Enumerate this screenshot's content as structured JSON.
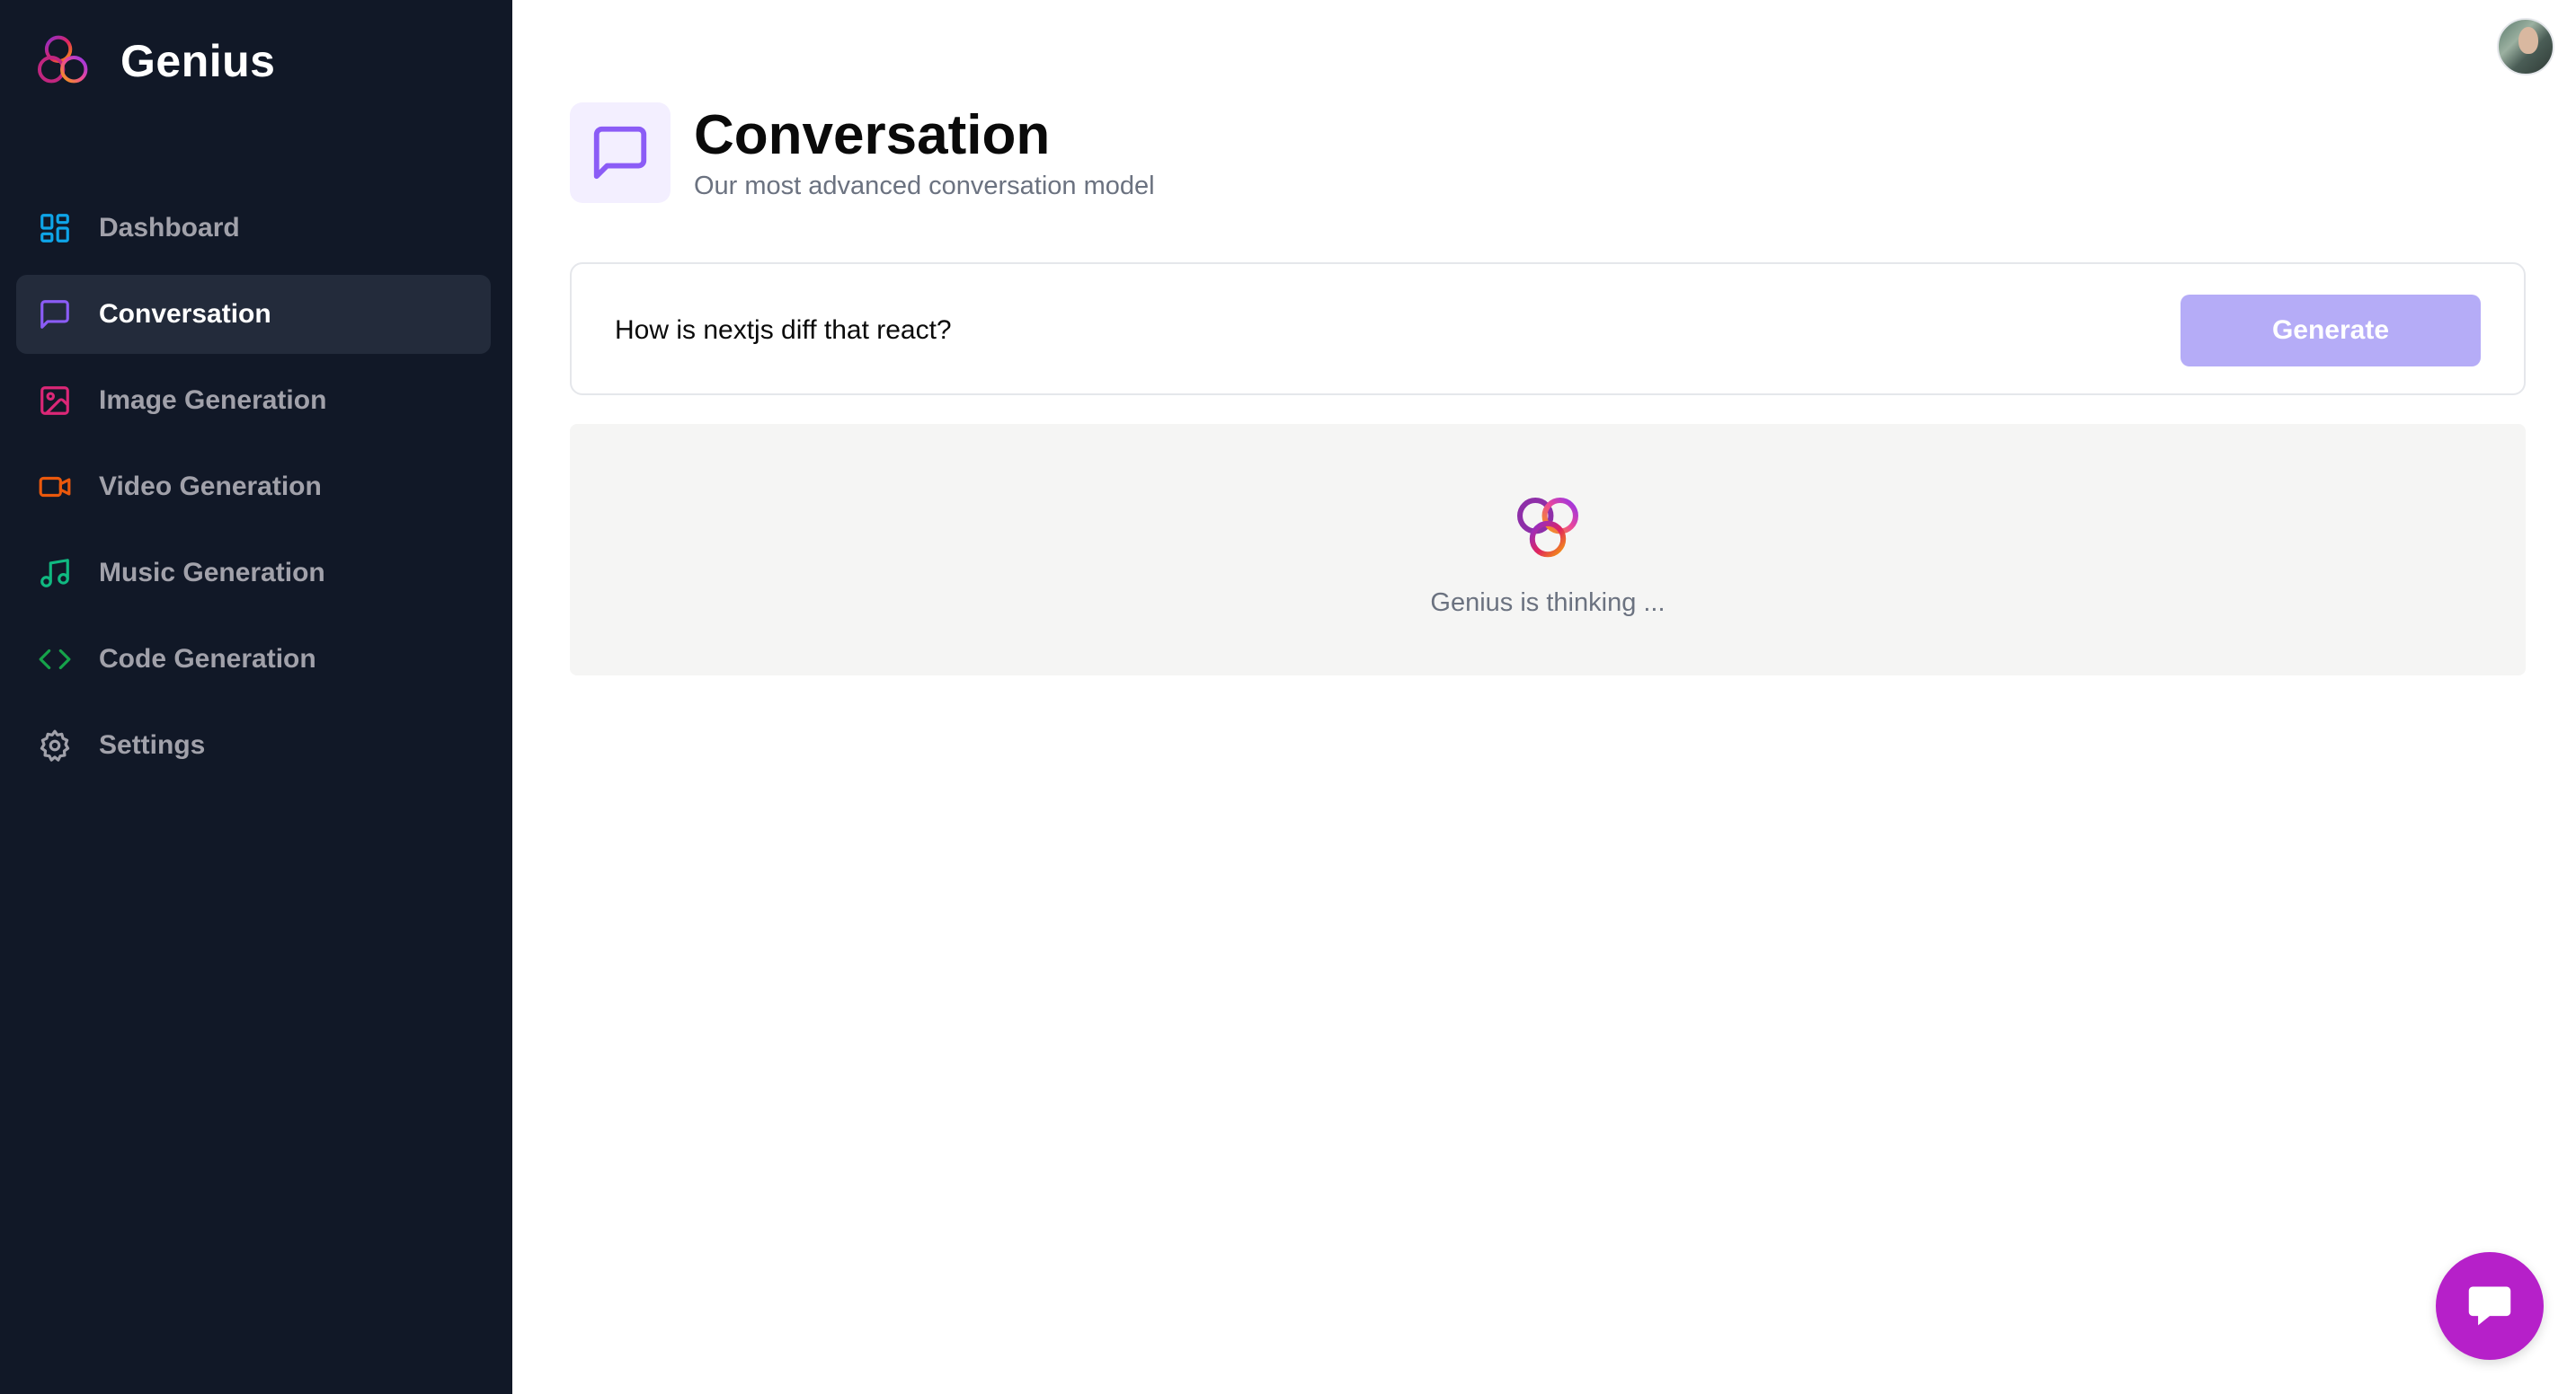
{
  "app": {
    "name": "Genius",
    "colors": {
      "sidebar_bg": "#111827",
      "active_item_bg": "#232b3b",
      "accent": "#8b5cf6",
      "generate_button": "#b5acf7",
      "chat_fab": "#b620c9"
    }
  },
  "sidebar": {
    "items": [
      {
        "label": "Dashboard",
        "icon": "layout-dashboard-icon",
        "color": "#0ea5e9",
        "active": false
      },
      {
        "label": "Conversation",
        "icon": "message-square-icon",
        "color": "#8b5cf6",
        "active": true
      },
      {
        "label": "Image Generation",
        "icon": "image-icon",
        "color": "#db2777",
        "active": false
      },
      {
        "label": "Video Generation",
        "icon": "video-icon",
        "color": "#ea580c",
        "active": false
      },
      {
        "label": "Music Generation",
        "icon": "music-icon",
        "color": "#10b981",
        "active": false
      },
      {
        "label": "Code Generation",
        "icon": "code-icon",
        "color": "#16a34a",
        "active": false
      },
      {
        "label": "Settings",
        "icon": "settings-icon",
        "color": "#a1a1aa",
        "active": false
      }
    ]
  },
  "header": {
    "title": "Conversation",
    "subtitle": "Our most advanced conversation model",
    "icon": "message-square-icon"
  },
  "prompt": {
    "value": "How is nextjs diff that react?",
    "button_label": "Generate"
  },
  "loader": {
    "text": "Genius is thinking ..."
  }
}
